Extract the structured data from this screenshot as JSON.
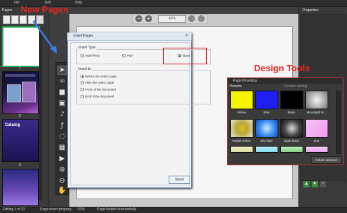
{
  "menu": [
    "File",
    "Edit",
    "Help"
  ],
  "left_panel": {
    "title": "Pages",
    "thumbnails": [
      {
        "label": "1"
      },
      {
        "label": "2",
        "title": "Catalog"
      },
      {
        "label": "3"
      }
    ]
  },
  "zoom": {
    "value": "42%",
    "zoom_out_icon": "minus",
    "zoom_in_icon": "plus"
  },
  "right_panel": {
    "title": "Properties"
  },
  "annotations": {
    "new_pages": "New Pages",
    "design_tools": "Design Tools"
  },
  "dialog": {
    "title": "Insert Pages",
    "insert_type": {
      "label": "Insert Type",
      "options": [
        "SWF/PNG",
        "PDF",
        "Blank"
      ],
      "selected": "Blank"
    },
    "insert_to": {
      "label": "Insert to",
      "options": [
        "Before the select page",
        "After the select page",
        "Front of the document",
        "End of the document"
      ],
      "selected": "Before the select page"
    },
    "insert_button": "Insert"
  },
  "fill_panel": {
    "title": "Page fill setting",
    "tabs": [
      "Presets",
      "Custom setting"
    ],
    "presets": [
      {
        "name": "Yellow",
        "color": "#f5f500"
      },
      {
        "name": "Blue",
        "color": "#1e1ef0"
      },
      {
        "name": "Black",
        "color": "#000000"
      },
      {
        "name": "Moonlight Si...",
        "color": "#c4c4c4"
      },
      {
        "name": "Radial Yellow",
        "color": "#d8c020"
      },
      {
        "name": "Sky Blue",
        "color": "#3a8ef0"
      },
      {
        "name": "Night black",
        "color": "#444444"
      },
      {
        "name": "pink",
        "color": "#f09af0"
      }
    ],
    "delete_button": "Delete selected"
  },
  "status": {
    "editing": "Editing 1 of 22",
    "zoom": "42%",
    "page_count": "Page insert property",
    "message": "Page loaded successfully"
  }
}
